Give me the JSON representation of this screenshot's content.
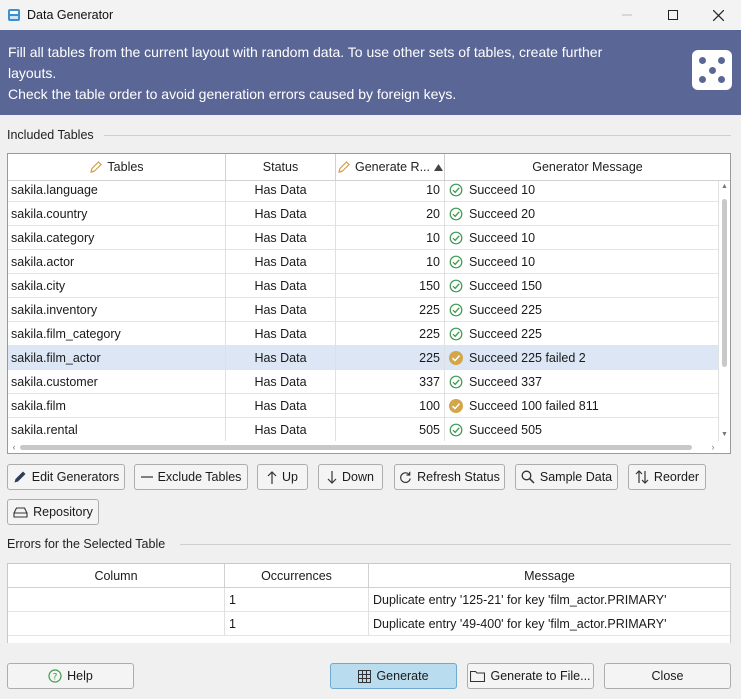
{
  "window": {
    "title": "Data Generator"
  },
  "banner": {
    "line1": "Fill all tables from the current layout with random data. To use other sets of tables, create further",
    "line2": "layouts.",
    "line3": "Check the table order to avoid generation errors caused by foreign keys."
  },
  "included_tables": {
    "title": "Included Tables",
    "columns": [
      "Tables",
      "Status",
      "Generate R...",
      "Generator Message"
    ],
    "rows": [
      {
        "table": "sakila.language",
        "status": "Has Data",
        "generate": "10",
        "message": "Succeed 10",
        "state": "ok"
      },
      {
        "table": "sakila.country",
        "status": "Has Data",
        "generate": "20",
        "message": "Succeed 20",
        "state": "ok"
      },
      {
        "table": "sakila.category",
        "status": "Has Data",
        "generate": "10",
        "message": "Succeed 10",
        "state": "ok"
      },
      {
        "table": "sakila.actor",
        "status": "Has Data",
        "generate": "10",
        "message": "Succeed 10",
        "state": "ok"
      },
      {
        "table": "sakila.city",
        "status": "Has Data",
        "generate": "150",
        "message": "Succeed 150",
        "state": "ok"
      },
      {
        "table": "sakila.inventory",
        "status": "Has Data",
        "generate": "225",
        "message": "Succeed 225",
        "state": "ok"
      },
      {
        "table": "sakila.film_category",
        "status": "Has Data",
        "generate": "225",
        "message": "Succeed 225",
        "state": "ok"
      },
      {
        "table": "sakila.film_actor",
        "status": "Has Data",
        "generate": "225",
        "message": "Succeed 225 failed 2",
        "state": "warn",
        "selected": true
      },
      {
        "table": "sakila.customer",
        "status": "Has Data",
        "generate": "337",
        "message": "Succeed 337",
        "state": "ok"
      },
      {
        "table": "sakila.film",
        "status": "Has Data",
        "generate": "100",
        "message": "Succeed 100 failed 811",
        "state": "warn"
      },
      {
        "table": "sakila.rental",
        "status": "Has Data",
        "generate": "505",
        "message": "Succeed 505",
        "state": "ok"
      }
    ]
  },
  "toolbar": {
    "edit_generators": "Edit Generators",
    "exclude_tables": "Exclude Tables",
    "up": "Up",
    "down": "Down",
    "refresh_status": "Refresh Status",
    "sample_data": "Sample Data",
    "reorder": "Reorder",
    "repository": "Repository"
  },
  "errors": {
    "title": "Errors for the Selected Table",
    "columns": [
      "Column",
      "Occurrences",
      "Message"
    ],
    "rows": [
      {
        "column": "",
        "occurrences": "1",
        "message": "Duplicate entry '125-21' for key 'film_actor.PRIMARY'"
      },
      {
        "column": "",
        "occurrences": "1",
        "message": "Duplicate entry '49-400' for key 'film_actor.PRIMARY'"
      }
    ]
  },
  "footer": {
    "help": "Help",
    "generate": "Generate",
    "generate_to_file": "Generate to File...",
    "close": "Close"
  },
  "colors": {
    "banner": "#5a6696",
    "selected_row": "#dce6f4",
    "success_icon": "#3c9a4e",
    "warning_icon": "#d3a64a",
    "primary_button": "#b9dcef"
  },
  "icons": {
    "app": "database-app-icon",
    "banner": "dice-icon",
    "success": "check-circle-icon",
    "warning": "warning-circle-icon"
  }
}
